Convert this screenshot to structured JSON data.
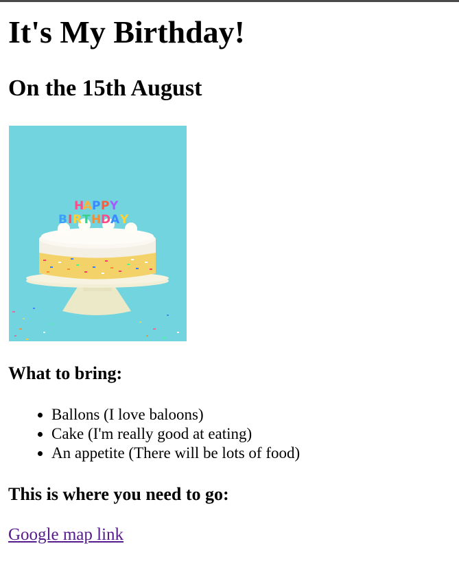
{
  "page": {
    "title": "It's My Birthday!",
    "subtitle": "On the 15th August",
    "bring_heading": "What to bring:",
    "bring_items": [
      "Ballons (I love baloons)",
      "Cake (I'm really good at eating)",
      "An appetite (There will be lots of food)"
    ],
    "go_heading": "This is where you need to go:",
    "map_link": "Google map link"
  },
  "image": {
    "cake_topper": "HAPPY BIRTHDAY",
    "cake_topper_top": "HAPPY",
    "cake_topper_bottom": "BIRTHDAY",
    "background_color": "#6fd3dc"
  },
  "colors": {
    "visited_link": "#551a8b",
    "text": "#000000"
  }
}
